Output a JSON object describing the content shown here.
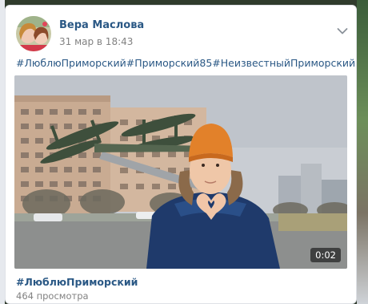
{
  "post": {
    "author_name": "Вера Маслова",
    "date": "31 мар в 18:43",
    "hashtags": "#ЛюблюПриморский#Приморский85#НеизвестныйПриморский",
    "menu_icon": "chevron-down-icon"
  },
  "video": {
    "duration": "0:02",
    "title": "#ЛюблюПриморский",
    "views": "464 просмотра"
  },
  "colors": {
    "link": "#2a5885",
    "secondary_text": "#828282",
    "card_background": "#ffffff"
  }
}
